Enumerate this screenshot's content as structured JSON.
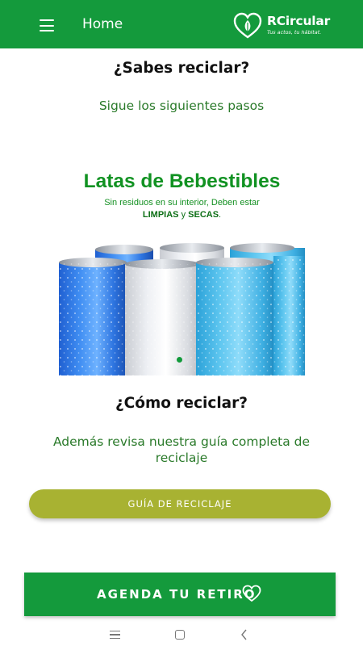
{
  "app_bar": {
    "menu_icon": "hamburger-menu-icon",
    "title": "Home",
    "logo": {
      "name": "RCircular",
      "tagline": "Tus actos, tu hábitat.",
      "icon": "leaf-heart-icon"
    }
  },
  "main": {
    "heading1": "¿Sabes reciclar?",
    "subtitle1": "Sigue los siguientes pasos",
    "carousel": {
      "slide_title": "Latas de Bebestibles",
      "slide_line1": "Sin residuos en su interior, Deben estar",
      "slide_limpias": "LIMPIAS",
      "slide_y": "y",
      "slide_secas": "SECAS",
      "slide_period": ".",
      "active_index": 0,
      "total_slides": 1
    },
    "heading2": "¿Cómo reciclar?",
    "subtitle2": "Además revisa nuestra guía completa de reciclaje",
    "guide_button": "GUÍA DE RECICLAJE"
  },
  "footer_button": {
    "label": "AGENDA TU RETIRO",
    "icon": "heart-outline-icon"
  },
  "system_nav": {
    "recent": "recent-apps-icon",
    "home": "home-icon",
    "back": "back-icon"
  },
  "colors": {
    "primary_green": "#149a3c",
    "olive_button": "#a8b232",
    "text_green": "#2a7a2a"
  }
}
